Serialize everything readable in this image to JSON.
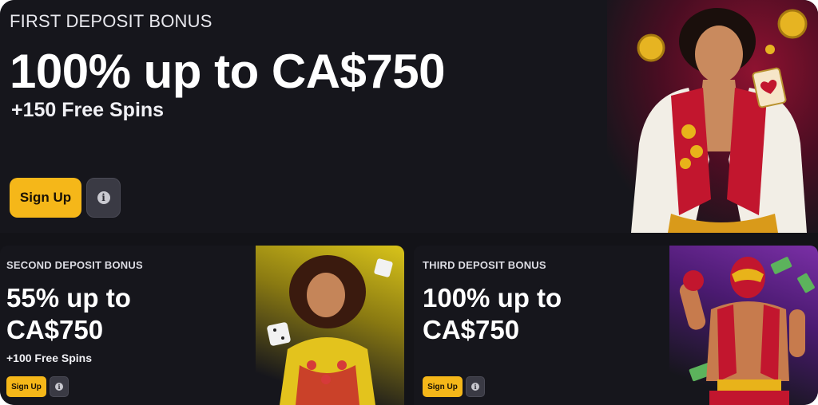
{
  "promos": {
    "first": {
      "eyebrow": "FIRST DEPOSIT BONUS",
      "headline": "100% up to CA$750",
      "sub": "+150 Free Spins",
      "cta": "Sign Up",
      "info_icon": "info-icon"
    },
    "second": {
      "eyebrow": "SECOND DEPOSIT BONUS",
      "headline_line1": "55% up to",
      "headline_line2": "CA$750",
      "sub": "+100 Free Spins",
      "cta": "Sign Up",
      "info_icon": "info-icon"
    },
    "third": {
      "eyebrow": "THIRD DEPOSIT BONUS",
      "headline_line1": "100% up to",
      "headline_line2": "CA$750",
      "cta": "Sign Up",
      "info_icon": "info-icon"
    }
  },
  "colors": {
    "background": "#131318",
    "card": "#16161c",
    "accent": "#f5b719",
    "info_button": "#3a3a44",
    "first_glow": "#8e1230",
    "second_glow": "#d9c41a",
    "third_glow": "#7a2fa6"
  }
}
